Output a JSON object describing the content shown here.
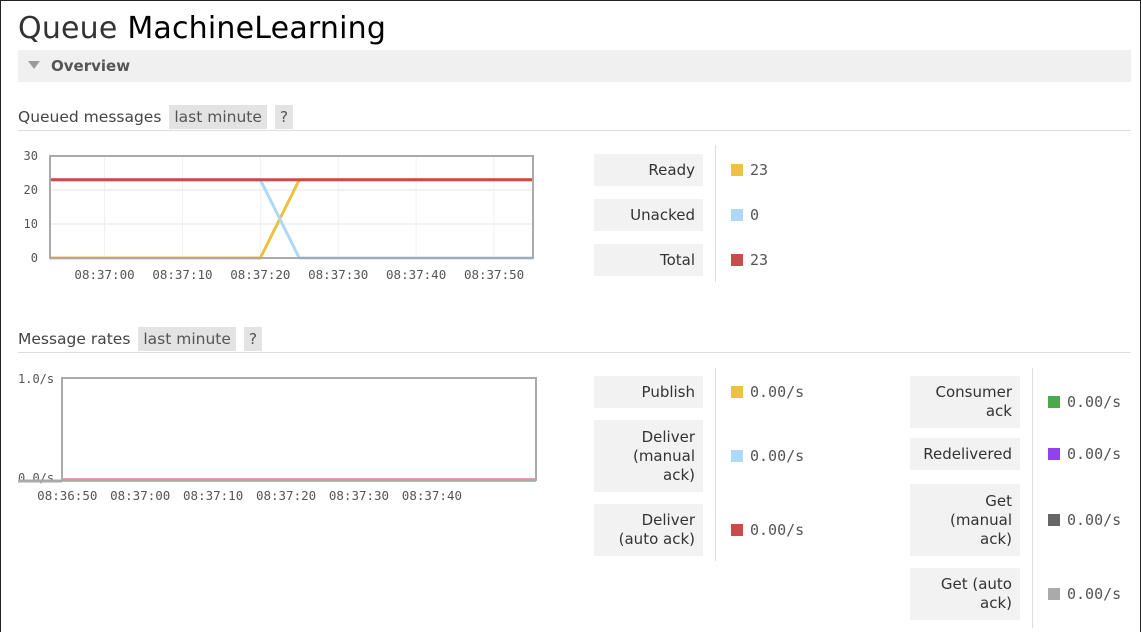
{
  "page": {
    "title_prefix": "Queue",
    "queue_name": "MachineLearning",
    "overview_label": "Overview"
  },
  "queued": {
    "title": "Queued messages",
    "range": "last minute",
    "help": "?"
  },
  "rates": {
    "title": "Message rates",
    "range": "last minute",
    "help": "?"
  },
  "legend_queued": [
    {
      "label": "Ready",
      "value": "23",
      "color": "#edc240"
    },
    {
      "label": "Unacked",
      "value": "0",
      "color": "#afd8f8"
    },
    {
      "label": "Total",
      "value": "23",
      "color": "#cb4b4b"
    }
  ],
  "legend_rates_left": [
    {
      "label": "Publish",
      "value": "0.00/s",
      "color": "#edc240"
    },
    {
      "label": "Deliver\n(manual\nack)",
      "value": "0.00/s",
      "color": "#afd8f8"
    },
    {
      "label": "Deliver\n(auto ack)",
      "value": "0.00/s",
      "color": "#cb4b4b"
    }
  ],
  "legend_rates_right": [
    {
      "label": "Consumer\nack",
      "value": "0.00/s",
      "color": "#4da74d"
    },
    {
      "label": "Redelivered",
      "value": "0.00/s",
      "color": "#9440ed"
    },
    {
      "label": "Get\n(manual\nack)",
      "value": "0.00/s",
      "color": "#666666"
    },
    {
      "label": "Get (auto\nack)",
      "value": "0.00/s",
      "color": "#aaaaaa"
    }
  ],
  "chart_data": [
    {
      "type": "line",
      "yticks": [
        "30",
        "20",
        "10",
        "0"
      ],
      "ylim": [
        0,
        30
      ],
      "xticks": [
        "08:37:00",
        "08:37:10",
        "08:37:20",
        "08:37:30",
        "08:37:40",
        "08:37:50"
      ],
      "x": [
        "08:36:53",
        "08:37:20",
        "08:37:25",
        "08:37:55"
      ],
      "series": [
        {
          "name": "Ready",
          "color": "#edc240",
          "values": [
            0,
            0,
            23,
            23
          ]
        },
        {
          "name": "Unacked",
          "color": "#afd8f8",
          "values": [
            23,
            23,
            0,
            0
          ]
        },
        {
          "name": "Total",
          "color": "#cb4b4b",
          "values": [
            23,
            23,
            23,
            23
          ]
        }
      ],
      "grid": true
    },
    {
      "type": "line",
      "yticks": [
        "1.0/s",
        "0.0/s"
      ],
      "ylim": [
        0,
        1
      ],
      "xticks": [
        "08:36:50",
        "08:37:00",
        "08:37:10",
        "08:37:20",
        "08:37:30",
        "08:37:40"
      ],
      "series": [
        {
          "name": "Publish",
          "color": "#edc240",
          "values": [
            0,
            0
          ]
        },
        {
          "name": "Deliver (auto ack)",
          "color": "#cb4b4b",
          "values": [
            0,
            0
          ]
        }
      ],
      "grid": false
    }
  ]
}
